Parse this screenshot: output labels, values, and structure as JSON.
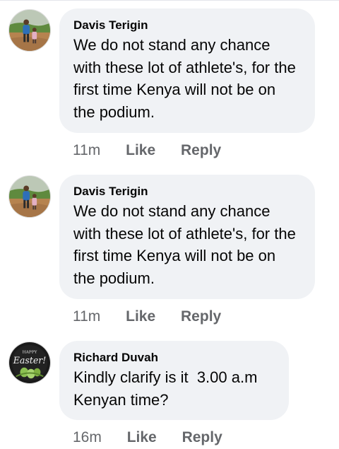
{
  "comments": [
    {
      "author": "Davis Terigin",
      "text": "We do not stand any chance with these lot of athlete's, for the first time Kenya will not be on the podium.",
      "time": "11m",
      "like_label": "Like",
      "reply_label": "Reply",
      "avatar_icon": "person-outdoors-photo-icon"
    },
    {
      "author": "Davis Terigin",
      "text": "We do not stand any chance with these lot of athlete's, for the first time Kenya will not be on the podium.",
      "time": "11m",
      "like_label": "Like",
      "reply_label": "Reply",
      "avatar_icon": "person-outdoors-photo-icon"
    },
    {
      "author": "Richard Duvah",
      "text": "Kindly clarify is it  3.00 a.m Kenyan time?",
      "time": "16m",
      "like_label": "Like",
      "reply_label": "Reply",
      "avatar_icon": "easter-greeting-icon",
      "avatar_text": "Happy Easter!"
    }
  ],
  "colors": {
    "bubble_bg": "#f0f2f5",
    "meta_text": "#65676b",
    "body_text": "#050505"
  }
}
